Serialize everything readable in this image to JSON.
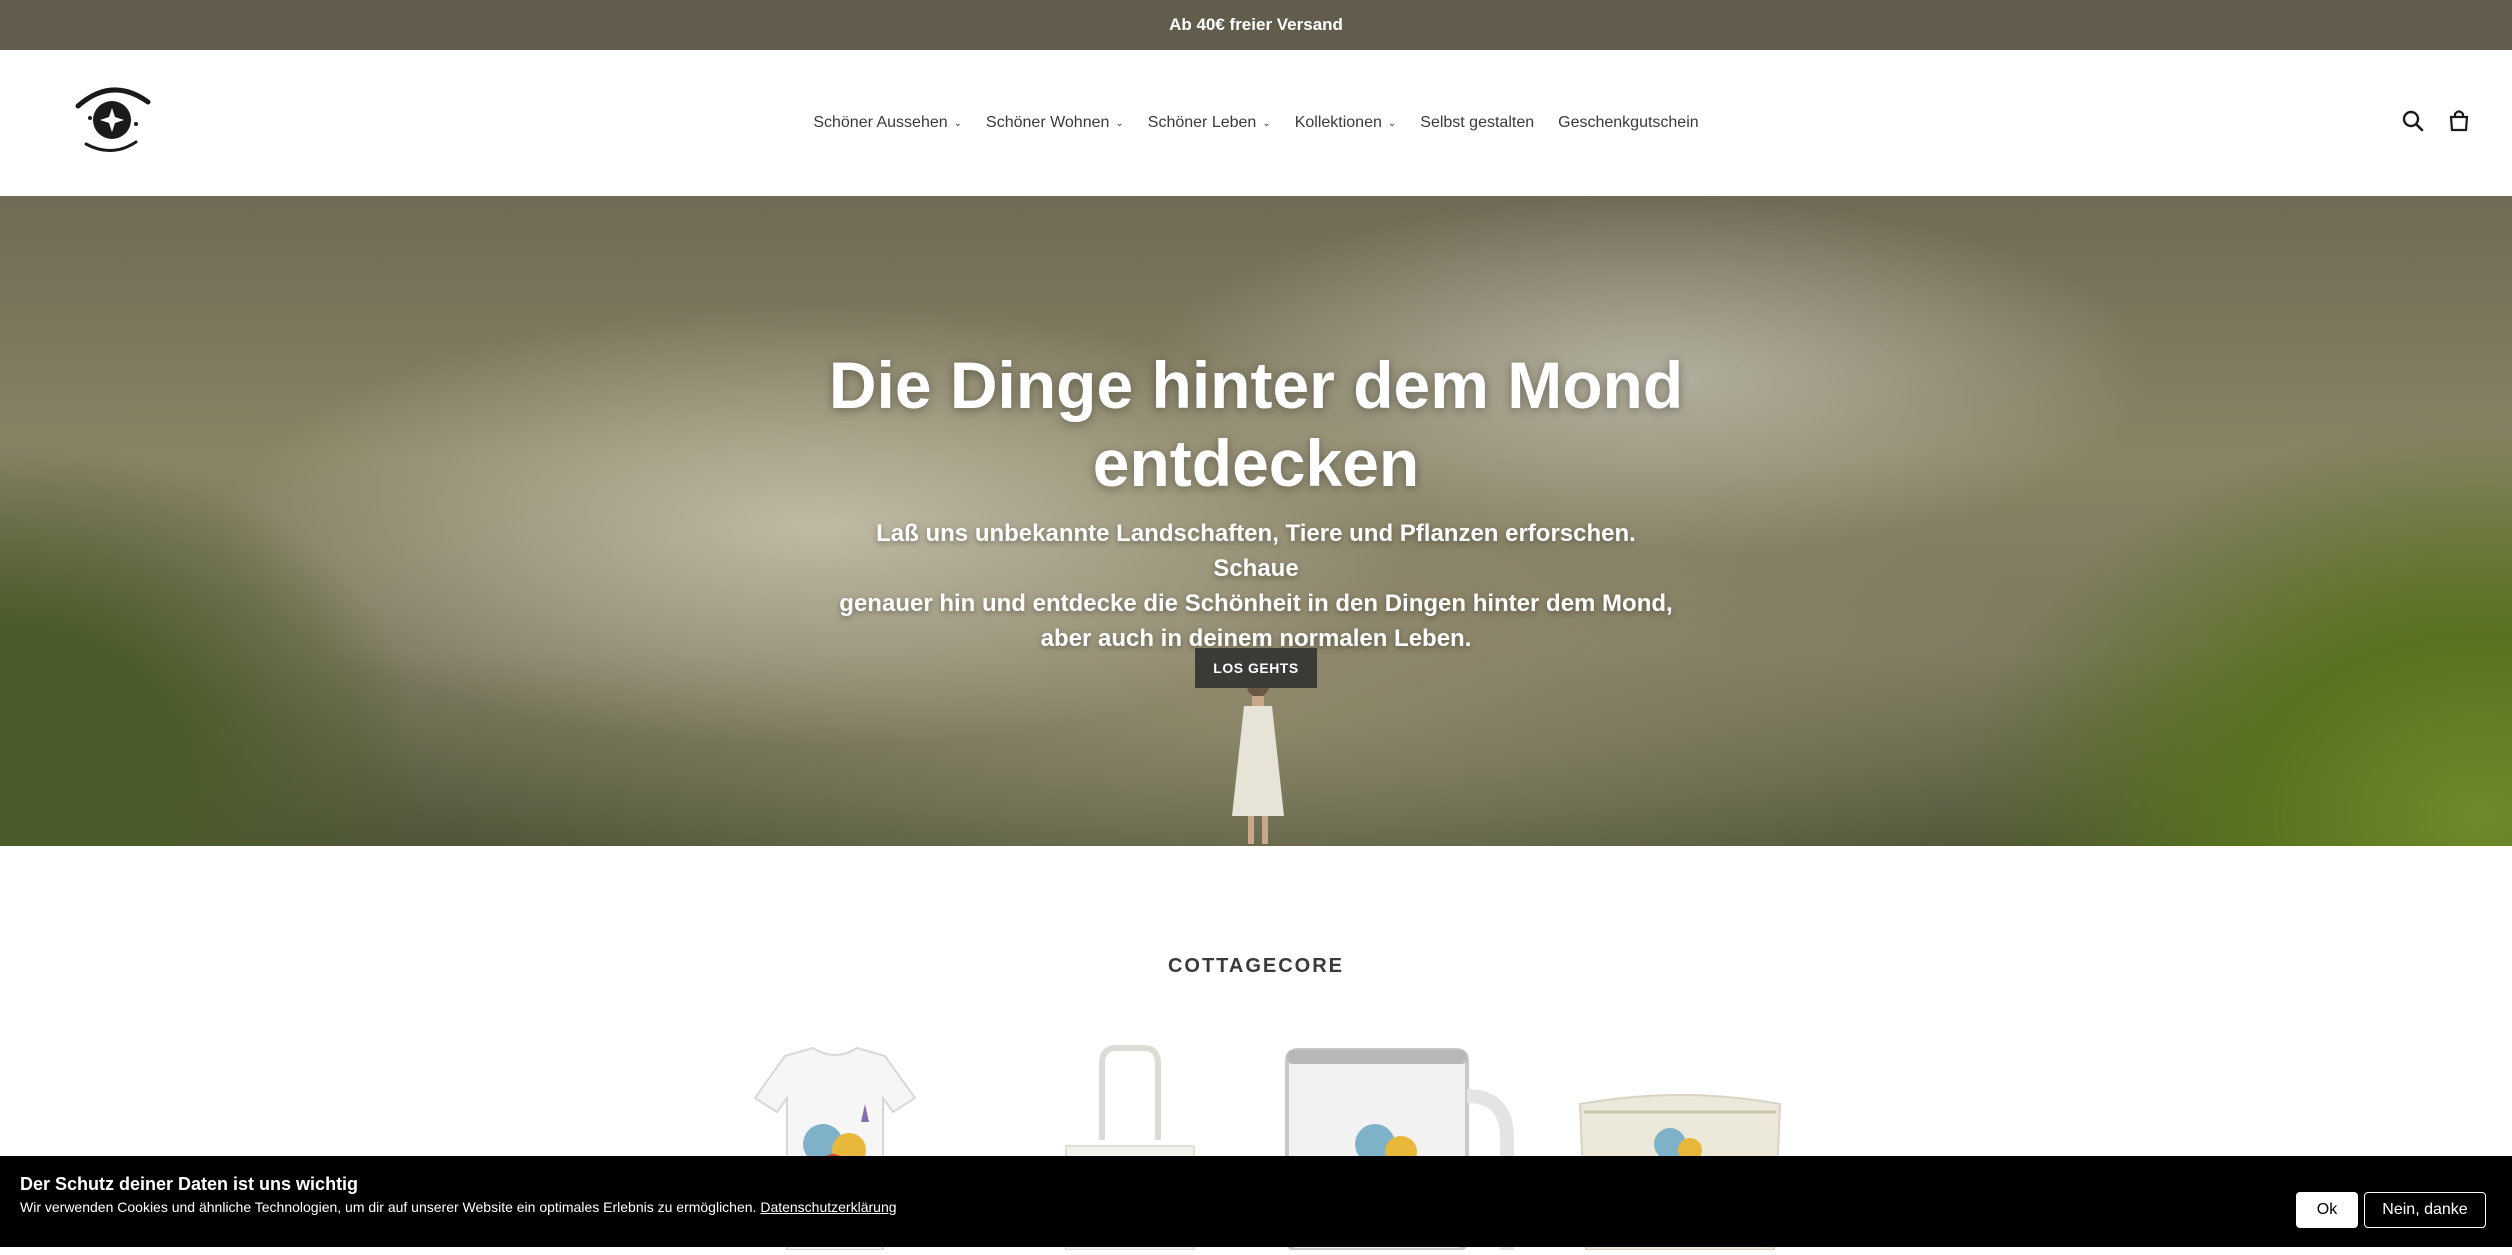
{
  "announcement": {
    "text": "Ab 40€ freier Versand"
  },
  "header": {
    "nav": [
      {
        "label": "Schöner Aussehen",
        "has_dropdown": true
      },
      {
        "label": "Schöner Wohnen",
        "has_dropdown": true
      },
      {
        "label": "Schöner Leben",
        "has_dropdown": true
      },
      {
        "label": "Kollektionen",
        "has_dropdown": true
      },
      {
        "label": "Selbst gestalten",
        "has_dropdown": false
      },
      {
        "label": "Geschenkgutschein",
        "has_dropdown": false
      }
    ],
    "icons": {
      "search": "search-icon",
      "cart": "cart-icon"
    }
  },
  "hero": {
    "title_line1": "Die Dinge hinter dem Mond",
    "title_line2": "entdecken",
    "subtitle_line1": "Laß uns unbekannte Landschaften, Tiere und Pflanzen erforschen. Schaue",
    "subtitle_line2": "genauer hin und entdecke die Schönheit in den Dingen hinter dem Mond,",
    "subtitle_line3": "aber auch in deinem normalen Leben.",
    "button_label": "LOS GEHTS"
  },
  "collection": {
    "title": "COTTAGECORE",
    "products": [
      "t-shirt",
      "tote-bag",
      "enamel-mug",
      "cosmetic-bag"
    ]
  },
  "cookie_banner": {
    "title": "Der Schutz deiner Daten ist uns wichtig",
    "text": "Wir verwenden Cookies und ähnliche Technologien, um dir auf unserer Website ein optimales Erlebnis zu ermöglichen.",
    "link_label": "Datenschutzerklärung",
    "ok_label": "Ok",
    "decline_label": "Nein, danke"
  },
  "colors": {
    "announcement_bg": "#615c4b",
    "button_bg": "#3b3a37",
    "cookie_bg": "#000000"
  }
}
